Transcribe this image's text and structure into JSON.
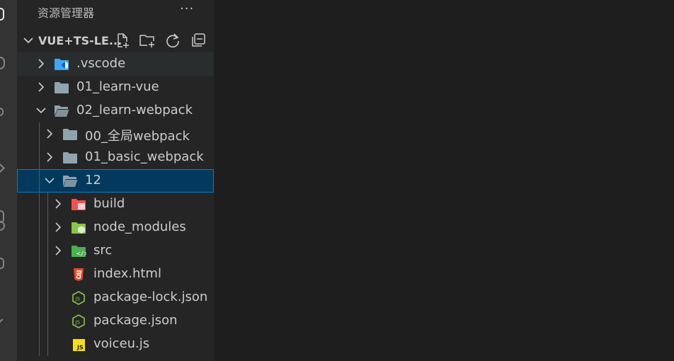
{
  "explorer": {
    "title": "资源管理器",
    "more_label": "···"
  },
  "section": {
    "title": "VUE+TS-LE..."
  },
  "tree": [
    {
      "label": ".vscode",
      "depth": 0,
      "kind": "folder",
      "expanded": false,
      "icon": "vscode-folder-icon",
      "state": "hover"
    },
    {
      "label": "01_learn-vue",
      "depth": 0,
      "kind": "folder",
      "expanded": false,
      "icon": "folder-icon",
      "state": "normal"
    },
    {
      "label": "02_learn-webpack",
      "depth": 0,
      "kind": "folder",
      "expanded": true,
      "icon": "folder-open-icon",
      "state": "normal"
    },
    {
      "label": "00_全局webpack",
      "depth": 1,
      "kind": "folder",
      "expanded": false,
      "icon": "folder-icon",
      "state": "normal"
    },
    {
      "label": "01_basic_webpack",
      "depth": 1,
      "kind": "folder",
      "expanded": false,
      "icon": "folder-icon",
      "state": "normal"
    },
    {
      "label": "12",
      "depth": 1,
      "kind": "folder",
      "expanded": true,
      "icon": "folder-open-icon",
      "state": "selected"
    },
    {
      "label": "build",
      "depth": 2,
      "kind": "folder",
      "expanded": false,
      "icon": "build-folder-icon",
      "state": "normal"
    },
    {
      "label": "node_modules",
      "depth": 2,
      "kind": "folder",
      "expanded": false,
      "icon": "node-folder-icon",
      "state": "normal"
    },
    {
      "label": "src",
      "depth": 2,
      "kind": "folder",
      "expanded": false,
      "icon": "src-folder-icon",
      "state": "normal"
    },
    {
      "label": "index.html",
      "depth": 2,
      "kind": "file",
      "icon": "html5-icon",
      "state": "normal"
    },
    {
      "label": "package-lock.json",
      "depth": 2,
      "kind": "file",
      "icon": "nodejs-icon",
      "state": "normal"
    },
    {
      "label": "package.json",
      "depth": 2,
      "kind": "file",
      "icon": "nodejs-icon",
      "state": "normal"
    },
    {
      "label": "voiceu.js",
      "depth": 2,
      "kind": "file",
      "icon": "javascript-icon",
      "state": "normal"
    }
  ],
  "colors": {
    "sidebar_bg": "#252526",
    "editor_bg": "#1e1e1e",
    "selection_bg": "#04395e",
    "selection_border": "#007fd4",
    "folder": "#90a4ae",
    "vscode_folder": "#42a5f5",
    "build_folder": "#ef5350",
    "node_folder": "#8bc34a",
    "src_folder": "#4caf50",
    "html": "#e44d26",
    "nodejs": "#8bc34a",
    "js": "#f5de19"
  }
}
